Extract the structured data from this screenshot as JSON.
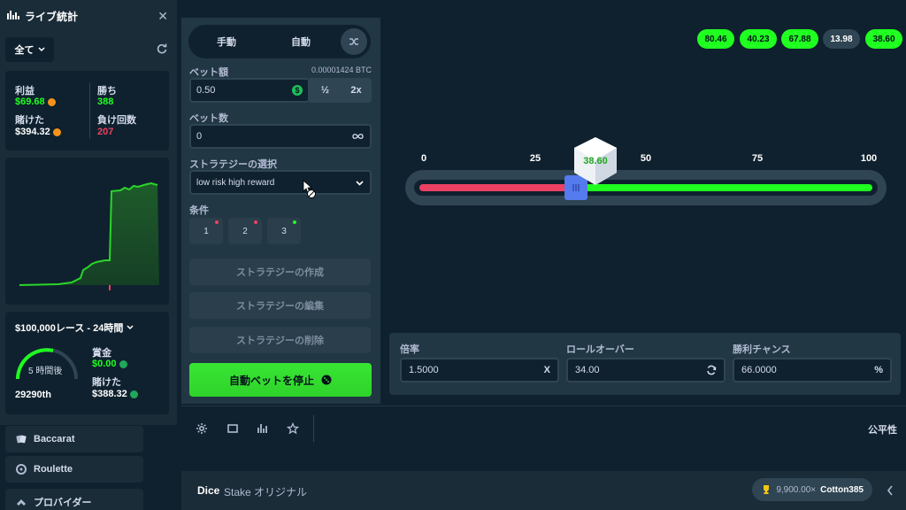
{
  "nav": {
    "baccarat": "Baccarat",
    "roulette": "Roulette",
    "providers": "プロバイダー"
  },
  "live_stats": {
    "title": "ライブ統計",
    "filter": "全て",
    "profit_label": "利益",
    "profit_value": "$69.68",
    "wagered_label": "賭けた",
    "wagered_value": "$394.32",
    "wins_label": "勝ち",
    "wins_value": "388",
    "losses_label": "負け回数",
    "losses_value": "207",
    "race": {
      "title": "$100,000レース - 24時間",
      "time_left": "5 時間後",
      "rank": "29290th",
      "prize_label": "賞金",
      "prize_value": "$0.00",
      "wagered_label": "賭けた",
      "wagered_value": "$388.32"
    }
  },
  "controls": {
    "tab_manual": "手動",
    "tab_auto": "自動",
    "bet_amount_label": "ベット額",
    "bet_amount_btc": "0.00001424 BTC",
    "bet_amount_value": "0.50",
    "half_label": "½",
    "double_label": "2x",
    "bet_count_label": "ベット数",
    "bet_count_value": "0",
    "strategy_label": "ストラテジーの選択",
    "strategy_value": "low risk high reward",
    "conditions_label": "条件",
    "conditions": [
      "1",
      "2",
      "3"
    ],
    "create_strategy": "ストラテジーの作成",
    "edit_strategy": "ストラテジーの編集",
    "delete_strategy": "ストラテジーの削除",
    "stop_autobet": "自動ベットを停止"
  },
  "game": {
    "history": [
      "80.46",
      "40.23",
      "67.88",
      "13.98",
      "38.60"
    ],
    "ticks": [
      "0",
      "25",
      "50",
      "75",
      "100"
    ],
    "roll_result": "38.60",
    "roll_percent": 38.6,
    "multiplier_label": "倍率",
    "multiplier_value": "1.5000",
    "multiplier_suffix": "X",
    "roll_over_label": "ロールオーバー",
    "roll_over_value": "34.00",
    "win_chance_label": "勝利チャンス",
    "win_chance_value": "66.0000",
    "win_chance_suffix": "%"
  },
  "toolbar": {
    "fairness": "公平性"
  },
  "footer": {
    "game_name": "Dice",
    "stake_original": "Stake オリジナル",
    "top_win_multiplier": "9,900.00×",
    "top_win_user": "Cotton385"
  },
  "colors": {
    "green": "#1fff20",
    "red": "#ed4163",
    "panel": "#213743",
    "background": "#0f212e"
  }
}
